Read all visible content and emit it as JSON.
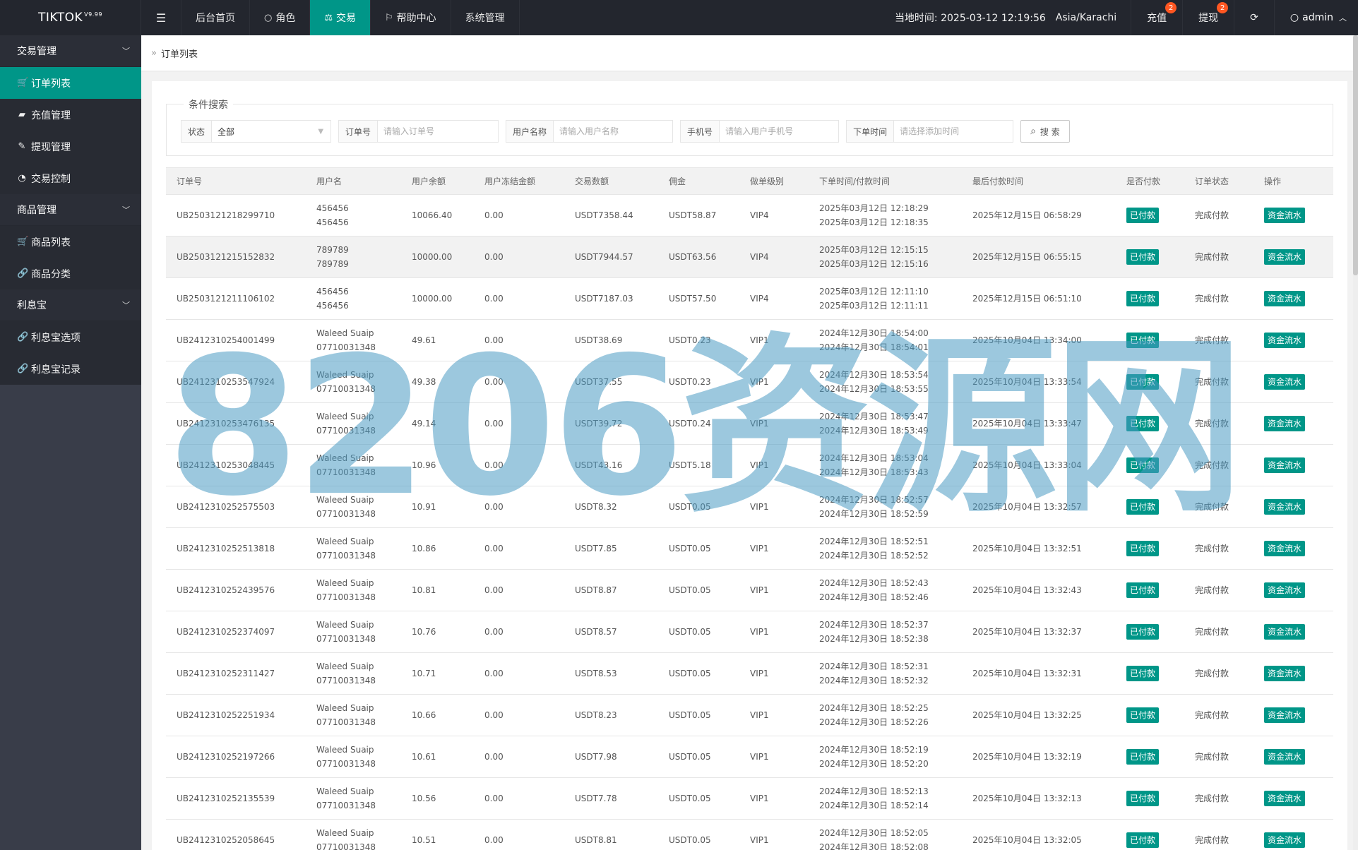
{
  "app": {
    "logo": "TIKTOK",
    "version": "V9.99"
  },
  "topnav": {
    "menu_icon": "menu-icon",
    "items": [
      {
        "label": "后台首页",
        "icon": ""
      },
      {
        "label": "角色",
        "icon": "user-icon"
      },
      {
        "label": "交易",
        "icon": "scale-icon"
      },
      {
        "label": "帮助中心",
        "icon": "flag-icon"
      },
      {
        "label": "系统管理",
        "icon": ""
      }
    ],
    "time_label": "当地时间: 2025-03-12 12:19:56",
    "timezone": "Asia/Karachi",
    "recharge": {
      "label": "充值",
      "badge": "2"
    },
    "withdraw": {
      "label": "提现",
      "badge": "2"
    },
    "user": "admin"
  },
  "sidebar": {
    "groups": [
      {
        "label": "交易管理",
        "items": [
          "订单列表",
          "充值管理",
          "提现管理",
          "交易控制"
        ]
      },
      {
        "label": "商品管理",
        "items": [
          "商品列表",
          "商品分类"
        ]
      },
      {
        "label": "利息宝",
        "items": [
          "利息宝选项",
          "利息宝记录"
        ]
      }
    ]
  },
  "breadcrumb": {
    "separator": "»",
    "current": "订单列表"
  },
  "search": {
    "legend": "条件搜索",
    "status": {
      "label": "状态",
      "value": "全部"
    },
    "order_no": {
      "label": "订单号",
      "placeholder": "请输入订单号"
    },
    "username": {
      "label": "用户名称",
      "placeholder": "请输入用户名称"
    },
    "phone": {
      "label": "手机号",
      "placeholder": "请输入用户手机号"
    },
    "time": {
      "label": "下单时间",
      "placeholder": "请选择添加时间"
    },
    "button": "搜 索"
  },
  "table": {
    "headers": [
      "订单号",
      "用户名",
      "用户余额",
      "用户冻结金额",
      "交易数额",
      "佣金",
      "做单级别",
      "下单时间/付款时间",
      "最后付款时间",
      "是否付款",
      "订单状态",
      "操作"
    ],
    "rows": [
      {
        "order": "UB2503121218299710",
        "user1": "456456",
        "user2": "456456",
        "balance": "10066.40",
        "frozen": "0.00",
        "amount": "USDT7358.44",
        "commission": "USDT58.87",
        "level": "VIP4",
        "t1": "2025年03月12日 12:18:29",
        "t2": "2025年03月12日 12:18:35",
        "last": "2025年12月15日 06:58:29",
        "paid": "已付款",
        "status": "完成付款",
        "action": "资金流水"
      },
      {
        "order": "UB2503121215152832",
        "user1": "789789",
        "user2": "789789",
        "balance": "10000.00",
        "frozen": "0.00",
        "amount": "USDT7944.57",
        "commission": "USDT63.56",
        "level": "VIP4",
        "t1": "2025年03月12日 12:15:15",
        "t2": "2025年03月12日 12:15:16",
        "last": "2025年12月15日 06:55:15",
        "paid": "已付款",
        "status": "完成付款",
        "action": "资金流水"
      },
      {
        "order": "UB2503121211106102",
        "user1": "456456",
        "user2": "456456",
        "balance": "10000.00",
        "frozen": "0.00",
        "amount": "USDT7187.03",
        "commission": "USDT57.50",
        "level": "VIP4",
        "t1": "2025年03月12日 12:11:10",
        "t2": "2025年03月12日 12:11:11",
        "last": "2025年12月15日 06:51:10",
        "paid": "已付款",
        "status": "完成付款",
        "action": "资金流水"
      },
      {
        "order": "UB2412310254001499",
        "user1": "Waleed Suaip",
        "user2": "07710031348",
        "balance": "49.61",
        "frozen": "0.00",
        "amount": "USDT38.69",
        "commission": "USDT0.23",
        "level": "VIP1",
        "t1": "2024年12月30日 18:54:00",
        "t2": "2024年12月30日 18:54:01",
        "last": "2025年10月04日 13:34:00",
        "paid": "已付款",
        "status": "完成付款",
        "action": "资金流水"
      },
      {
        "order": "UB2412310253547924",
        "user1": "Waleed Suaip",
        "user2": "07710031348",
        "balance": "49.38",
        "frozen": "0.00",
        "amount": "USDT37.55",
        "commission": "USDT0.23",
        "level": "VIP1",
        "t1": "2024年12月30日 18:53:54",
        "t2": "2024年12月30日 18:53:55",
        "last": "2025年10月04日 13:33:54",
        "paid": "已付款",
        "status": "完成付款",
        "action": "资金流水"
      },
      {
        "order": "UB2412310253476135",
        "user1": "Waleed Suaip",
        "user2": "07710031348",
        "balance": "49.14",
        "frozen": "0.00",
        "amount": "USDT39.72",
        "commission": "USDT0.24",
        "level": "VIP1",
        "t1": "2024年12月30日 18:53:47",
        "t2": "2024年12月30日 18:53:49",
        "last": "2025年10月04日 13:33:47",
        "paid": "已付款",
        "status": "完成付款",
        "action": "资金流水"
      },
      {
        "order": "UB2412310253048445",
        "user1": "Waleed Suaip",
        "user2": "07710031348",
        "balance": "10.96",
        "frozen": "0.00",
        "amount": "USDT43.16",
        "commission": "USDT5.18",
        "level": "VIP1",
        "t1": "2024年12月30日 18:53:04",
        "t2": "2024年12月30日 18:53:43",
        "last": "2025年10月04日 13:33:04",
        "paid": "已付款",
        "status": "完成付款",
        "action": "资金流水"
      },
      {
        "order": "UB2412310252575503",
        "user1": "Waleed Suaip",
        "user2": "07710031348",
        "balance": "10.91",
        "frozen": "0.00",
        "amount": "USDT8.32",
        "commission": "USDT0.05",
        "level": "VIP1",
        "t1": "2024年12月30日 18:52:57",
        "t2": "2024年12月30日 18:52:59",
        "last": "2025年10月04日 13:32:57",
        "paid": "已付款",
        "status": "完成付款",
        "action": "资金流水"
      },
      {
        "order": "UB2412310252513818",
        "user1": "Waleed Suaip",
        "user2": "07710031348",
        "balance": "10.86",
        "frozen": "0.00",
        "amount": "USDT7.85",
        "commission": "USDT0.05",
        "level": "VIP1",
        "t1": "2024年12月30日 18:52:51",
        "t2": "2024年12月30日 18:52:52",
        "last": "2025年10月04日 13:32:51",
        "paid": "已付款",
        "status": "完成付款",
        "action": "资金流水"
      },
      {
        "order": "UB2412310252439576",
        "user1": "Waleed Suaip",
        "user2": "07710031348",
        "balance": "10.81",
        "frozen": "0.00",
        "amount": "USDT8.87",
        "commission": "USDT0.05",
        "level": "VIP1",
        "t1": "2024年12月30日 18:52:43",
        "t2": "2024年12月30日 18:52:46",
        "last": "2025年10月04日 13:32:43",
        "paid": "已付款",
        "status": "完成付款",
        "action": "资金流水"
      },
      {
        "order": "UB2412310252374097",
        "user1": "Waleed Suaip",
        "user2": "07710031348",
        "balance": "10.76",
        "frozen": "0.00",
        "amount": "USDT8.57",
        "commission": "USDT0.05",
        "level": "VIP1",
        "t1": "2024年12月30日 18:52:37",
        "t2": "2024年12月30日 18:52:38",
        "last": "2025年10月04日 13:32:37",
        "paid": "已付款",
        "status": "完成付款",
        "action": "资金流水"
      },
      {
        "order": "UB2412310252311427",
        "user1": "Waleed Suaip",
        "user2": "07710031348",
        "balance": "10.71",
        "frozen": "0.00",
        "amount": "USDT8.53",
        "commission": "USDT0.05",
        "level": "VIP1",
        "t1": "2024年12月30日 18:52:31",
        "t2": "2024年12月30日 18:52:32",
        "last": "2025年10月04日 13:32:31",
        "paid": "已付款",
        "status": "完成付款",
        "action": "资金流水"
      },
      {
        "order": "UB2412310252251934",
        "user1": "Waleed Suaip",
        "user2": "07710031348",
        "balance": "10.66",
        "frozen": "0.00",
        "amount": "USDT8.23",
        "commission": "USDT0.05",
        "level": "VIP1",
        "t1": "2024年12月30日 18:52:25",
        "t2": "2024年12月30日 18:52:26",
        "last": "2025年10月04日 13:32:25",
        "paid": "已付款",
        "status": "完成付款",
        "action": "资金流水"
      },
      {
        "order": "UB2412310252197266",
        "user1": "Waleed Suaip",
        "user2": "07710031348",
        "balance": "10.61",
        "frozen": "0.00",
        "amount": "USDT7.98",
        "commission": "USDT0.05",
        "level": "VIP1",
        "t1": "2024年12月30日 18:52:19",
        "t2": "2024年12月30日 18:52:20",
        "last": "2025年10月04日 13:32:19",
        "paid": "已付款",
        "status": "完成付款",
        "action": "资金流水"
      },
      {
        "order": "UB2412310252135539",
        "user1": "Waleed Suaip",
        "user2": "07710031348",
        "balance": "10.56",
        "frozen": "0.00",
        "amount": "USDT7.78",
        "commission": "USDT0.05",
        "level": "VIP1",
        "t1": "2024年12月30日 18:52:13",
        "t2": "2024年12月30日 18:52:14",
        "last": "2025年10月04日 13:32:13",
        "paid": "已付款",
        "status": "完成付款",
        "action": "资金流水"
      },
      {
        "order": "UB2412310252058645",
        "user1": "Waleed Suaip",
        "user2": "07710031348",
        "balance": "10.51",
        "frozen": "0.00",
        "amount": "USDT8.81",
        "commission": "USDT0.05",
        "level": "VIP1",
        "t1": "2024年12月30日 18:52:05",
        "t2": "2024年12月30日 18:52:08",
        "last": "2025年10月04日 13:32:05",
        "paid": "已付款",
        "status": "完成付款",
        "action": "资金流水"
      }
    ]
  },
  "watermark": "8206资源网",
  "colors": {
    "accent": "#009688",
    "topbar": "#23262e",
    "sidebar": "#393d49",
    "badge": "#ff5722"
  }
}
